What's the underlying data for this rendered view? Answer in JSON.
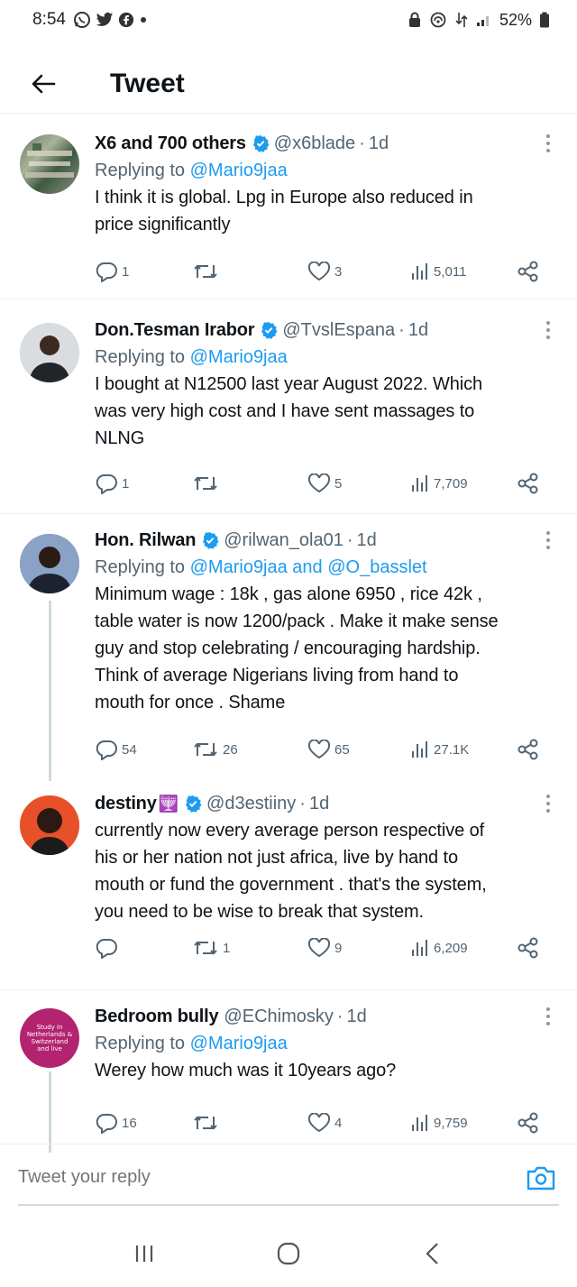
{
  "status_bar": {
    "time": "8:54",
    "left_icons": [
      "whatsapp-icon",
      "twitter-icon",
      "facebook-icon",
      "dot-icon"
    ],
    "right_icons": [
      "vpn-icon",
      "wifi-hotspot-icon",
      "data-icon",
      "signal-icon"
    ],
    "battery": "52%"
  },
  "header": {
    "back_icon": "arrow-left-icon",
    "title": "Tweet"
  },
  "tweets": [
    {
      "display_name": "X6 and 700 others",
      "handle": "@x6blade",
      "separator": "·",
      "time": "1d",
      "replying_prefix": "Replying to",
      "replying_to": "@Mario9jaa",
      "text": [
        "I think it is global.  Lpg in Europe also reduced in",
        "price significantly"
      ],
      "replies": "1",
      "retweets": "",
      "likes": "3",
      "views": "5,011"
    },
    {
      "display_name": "Don.Tesman Irabor",
      "handle": "@TvslEspana",
      "separator": "·",
      "time": "1d",
      "replying_prefix": "Replying to",
      "replying_to": "@Mario9jaa",
      "text": [
        "I bought at N12500 last year August 2022. Which",
        "was very high cost and I have sent massages to",
        "NLNG"
      ],
      "replies": "1",
      "retweets": "",
      "likes": "5",
      "views": "7,709"
    },
    {
      "display_name": "Hon. Rilwan",
      "handle": "@rilwan_ola01",
      "separator": "·",
      "time": "1d",
      "replying_prefix": "Replying to",
      "replying_to": "@Mario9jaa and @O_basslet",
      "text": [
        "Minimum wage : 18k , gas alone 6950 , rice 42k ,",
        "table water is now 1200/pack . Make it make sense",
        "guy and stop celebrating / encouraging hardship.",
        "Think of average Nigerians living from hand to",
        "mouth for once . Shame"
      ],
      "replies": "54",
      "retweets": "26",
      "likes": "65",
      "views": "27.1K"
    },
    {
      "display_name": "destiny",
      "name_emoji": "🕎",
      "handle": "@d3estiiny",
      "separator": "·",
      "time": "1d",
      "text": [
        "currently now every average person respective of",
        "his or her nation not just africa, live by hand to",
        "mouth or fund the government . that's the system,",
        "you need to be wise to break that system."
      ],
      "replies": "",
      "retweets": "1",
      "likes": "9",
      "views": "6,209"
    },
    {
      "display_name": "Bedroom bully",
      "handle": "@EChimosky",
      "separator": "·",
      "time": "1d",
      "replying_prefix": "Replying to",
      "replying_to": "@Mario9jaa",
      "text": [
        "Werey how much was it 10years ago?"
      ],
      "replies": "16",
      "retweets": "",
      "likes": "4",
      "views": "9,759",
      "avatar_text": "Study in Netherlands & Switzerland and live"
    }
  ],
  "reply_bar": {
    "placeholder": "Tweet your reply",
    "camera_icon": "camera-icon"
  },
  "nav_bar": {
    "icons": [
      "recent-apps-icon",
      "home-icon",
      "back-icon"
    ]
  },
  "colors": {
    "accent": "#1d9bf0",
    "text": "#0f1419",
    "muted": "#536471",
    "divider": "#eceff1"
  }
}
